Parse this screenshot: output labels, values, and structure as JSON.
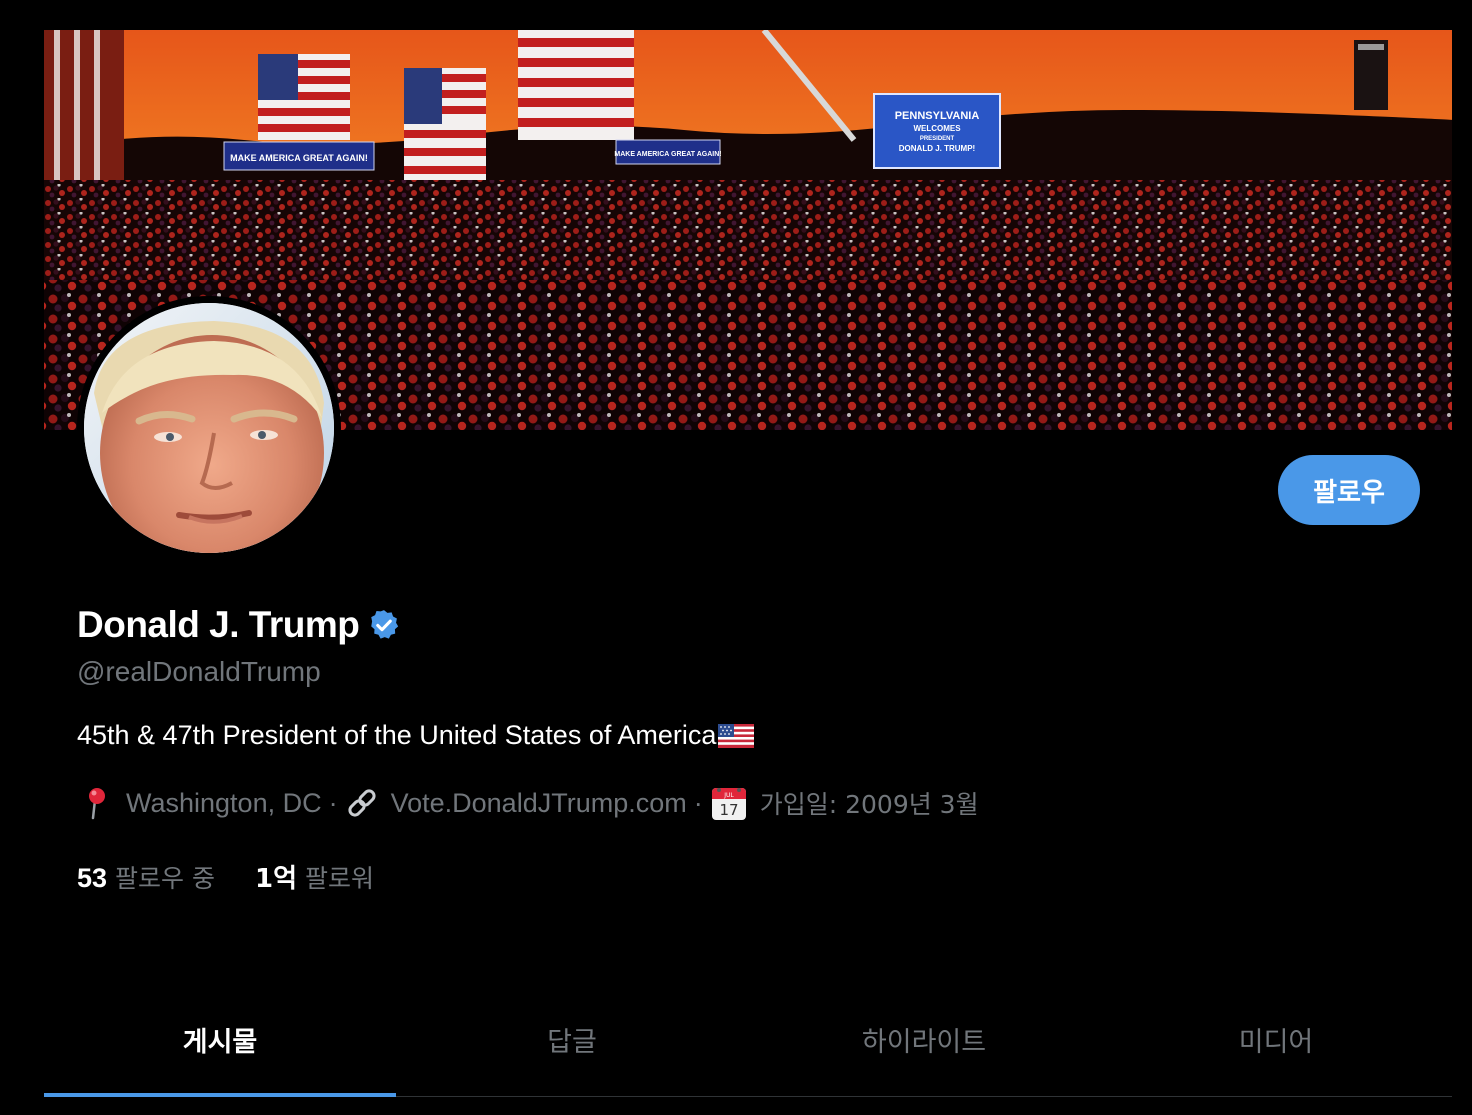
{
  "profile": {
    "display_name": "Donald J. Trump",
    "handle": "@realDonaldTrump",
    "verified": true,
    "bio": "45th & 47th President of the United States of America",
    "bio_emoji": "flag-us-icon",
    "location": "Washington, DC",
    "website": "Vote.DonaldJTrump.com",
    "joined": "가입일: 2009년 3월",
    "calendar_icon_month": "JUL",
    "calendar_icon_day": "17"
  },
  "banner": {
    "sign_left": "MAKE AMERICA GREAT AGAIN!",
    "sign_middle": "MAKE AMERICA GREAT AGAIN!",
    "screen_line1": "PENNSYLVANIA",
    "screen_line2": "WELCOMES",
    "screen_line3": "PRESIDENT",
    "screen_line4": "DONALD J. TRUMP!"
  },
  "actions": {
    "follow_label": "팔로우"
  },
  "stats": {
    "following_value": "53",
    "following_label": "팔로우 중",
    "followers_value": "1억",
    "followers_label": "팔로워"
  },
  "tabs": [
    {
      "label": "게시물",
      "active": true
    },
    {
      "label": "답글",
      "active": false
    },
    {
      "label": "하이라이트",
      "active": false
    },
    {
      "label": "미디어",
      "active": false
    }
  ],
  "colors": {
    "accent": "#4a98e8",
    "muted": "#71767b",
    "background": "#000000",
    "text": "#ffffff"
  },
  "icons": {
    "location": "pin-icon",
    "website": "link-icon",
    "joined": "calendar-icon",
    "verified": "verified-badge-icon"
  }
}
